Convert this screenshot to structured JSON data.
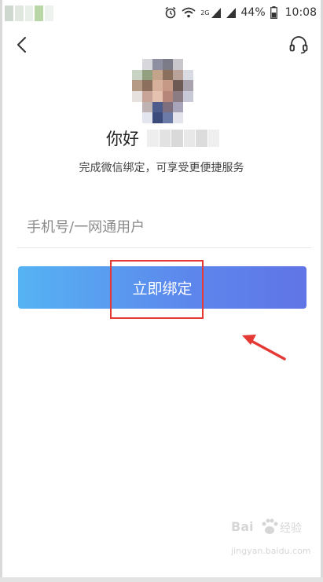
{
  "status_bar": {
    "battery_percent": "44%",
    "time": "10:08",
    "network_label": "2G"
  },
  "nav": {
    "back_icon": "chevron-left-icon",
    "support_icon": "headset-icon"
  },
  "profile": {
    "greeting": "你好",
    "subtitle": "完成微信绑定，可享受更便捷服务"
  },
  "form": {
    "phone_placeholder": "手机号/一网通用户",
    "phone_value": "",
    "bind_button_label": "立即绑定"
  },
  "annotation": {
    "highlight_color": "#e53935"
  },
  "watermark": {
    "brand": "Bai",
    "suffix": "经验",
    "url": "jingyan.baidu.com"
  },
  "colors": {
    "button_gradient_start": "#55b3f3",
    "button_gradient_end": "#6075e6"
  }
}
